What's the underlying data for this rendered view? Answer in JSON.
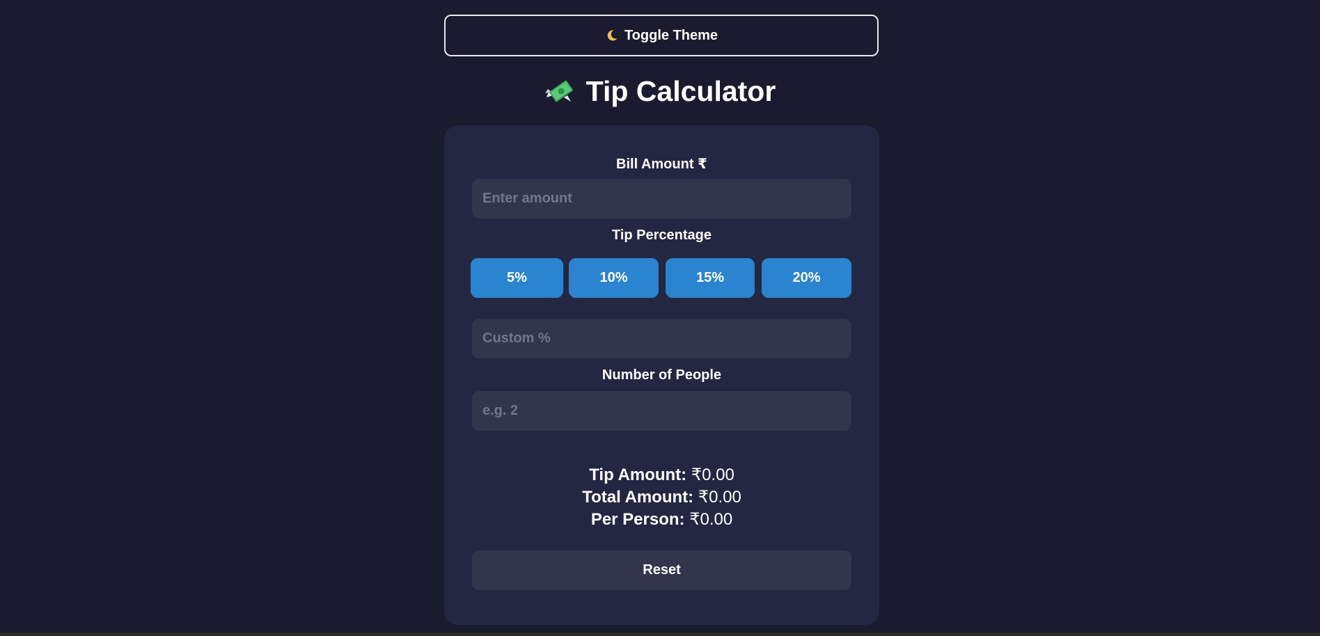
{
  "theme_toggle": {
    "label": "Toggle Theme",
    "icon": "moon-icon"
  },
  "header": {
    "title": "Tip Calculator",
    "icon": "money-with-wings-icon"
  },
  "bill": {
    "label": "Bill Amount ₹",
    "placeholder": "Enter amount",
    "value": ""
  },
  "tip": {
    "label": "Tip Percentage",
    "options": [
      "5%",
      "10%",
      "15%",
      "20%"
    ],
    "custom_placeholder": "Custom %",
    "custom_value": ""
  },
  "people": {
    "label": "Number of People",
    "placeholder": "e.g. 2",
    "value": ""
  },
  "results": {
    "tip_label": "Tip Amount:",
    "tip_value": "₹0.00",
    "total_label": "Total Amount:",
    "total_value": "₹0.00",
    "per_person_label": "Per Person:",
    "per_person_value": "₹0.00"
  },
  "reset_label": "Reset",
  "colors": {
    "background": "#1a1b2e",
    "card": "#242741",
    "input": "#33354c",
    "accent": "#2a84cf",
    "text": "#ffffff"
  }
}
